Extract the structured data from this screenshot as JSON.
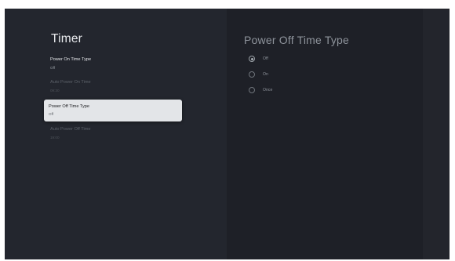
{
  "left_panel": {
    "title": "Timer",
    "items": [
      {
        "label": "Power On Time Type",
        "value": "Off",
        "state": "enabled"
      },
      {
        "label": "Auto Power On Time",
        "value": "09:30",
        "state": "disabled"
      },
      {
        "label": "Power Off Time Type",
        "value": "Off",
        "state": "focused"
      },
      {
        "label": "Auto Power Off Time",
        "value": "19:00",
        "state": "disabled"
      }
    ]
  },
  "right_panel": {
    "title": "Power Off Time Type",
    "options": [
      {
        "label": "Off",
        "selected": true
      },
      {
        "label": "On",
        "selected": false
      },
      {
        "label": "Once",
        "selected": false
      }
    ]
  },
  "colors": {
    "background": "#1f2229",
    "focus_highlight": "#e3e5e8",
    "text_primary": "#e6e8eb",
    "text_disabled": "#5d626a"
  }
}
